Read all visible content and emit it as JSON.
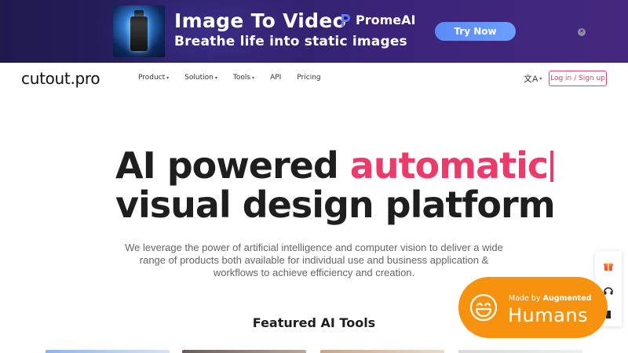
{
  "banner": {
    "title": "Image To Video",
    "subtitle": "Breathe life into static images",
    "brand": "PromeAI",
    "cta_label": "Try Now",
    "close_glyph": "×",
    "icons": [
      "promeai-logo-icon",
      "close-icon"
    ],
    "colors": {
      "background": "#2b2066",
      "cta": "#6aa0ff"
    }
  },
  "nav": {
    "logo": "cutout.pro",
    "items": [
      {
        "label": "Product",
        "has_menu": true
      },
      {
        "label": "Solution",
        "has_menu": true
      },
      {
        "label": "Tools",
        "has_menu": true
      },
      {
        "label": "API",
        "has_menu": false
      },
      {
        "label": "Pricing",
        "has_menu": false
      }
    ],
    "chevron_glyph": "▾",
    "language_glyph": "文A",
    "login_label": "Log in / Sign up",
    "colors": {
      "accent": "#e8406e"
    }
  },
  "hero": {
    "line1_prefix": "AI powered ",
    "line1_accent": "automatic",
    "line2": "visual design platform",
    "description": "We leverage the power of artificial intelligence and computer vision to deliver a wide range of products both available for individual use and business application & workflows to achieve efficiency and creation.",
    "colors": {
      "accent": "#ec3b6a",
      "heading": "#1e1e1e"
    }
  },
  "featured": {
    "heading": "Featured AI Tools"
  },
  "side_widget": {
    "icons": [
      "gift-icon",
      "headset-icon",
      "bookmark-icon"
    ]
  },
  "badge": {
    "made_by": "Made by",
    "augmented": "Augmented",
    "humans": "Humans",
    "colors": {
      "background": "#f7920f"
    }
  }
}
